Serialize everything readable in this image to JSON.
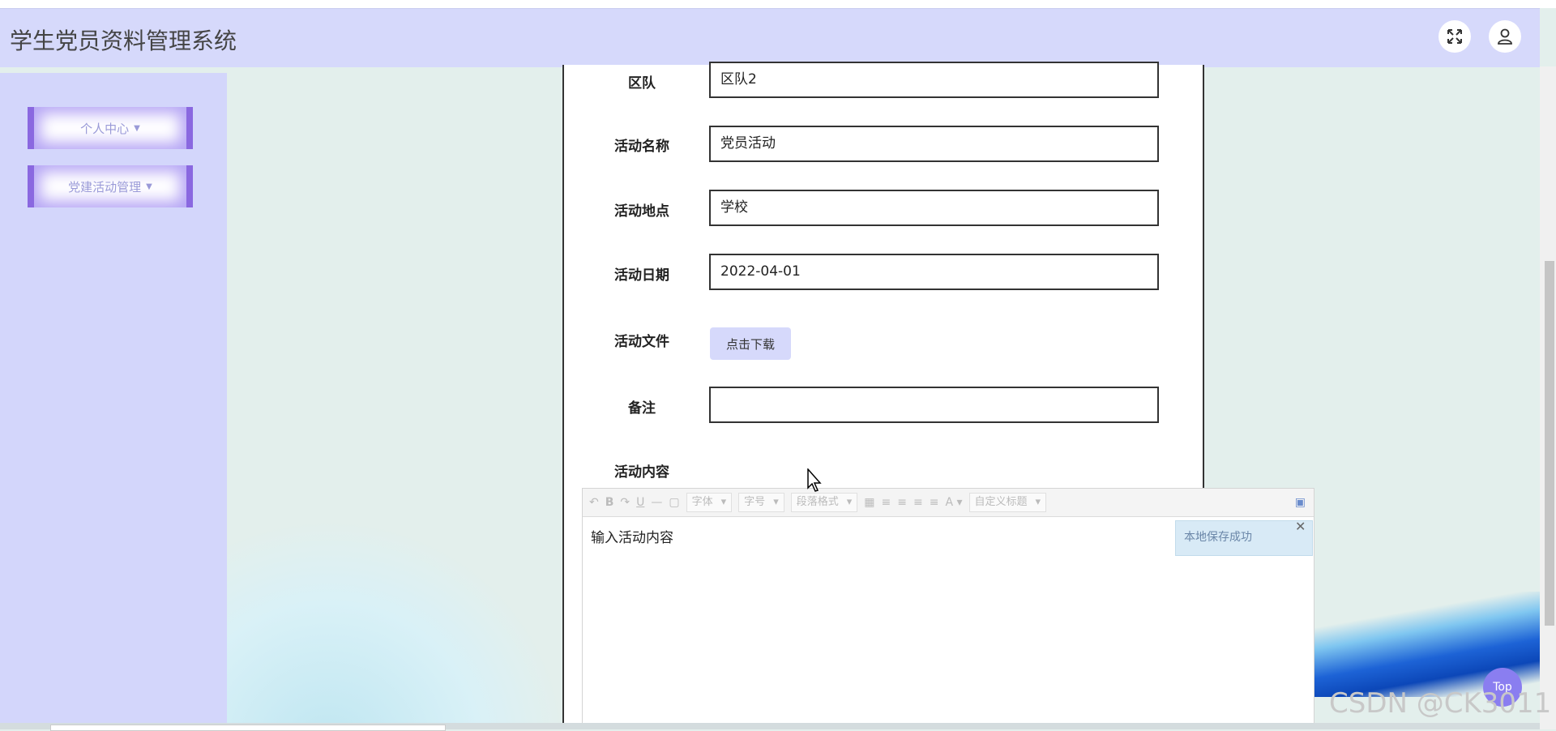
{
  "header": {
    "title": "学生党员资料管理系统",
    "icons": [
      "fullscreen-icon",
      "user-icon"
    ]
  },
  "sidebar": {
    "items": [
      {
        "label": "个人中心"
      },
      {
        "label": "党建活动管理"
      }
    ]
  },
  "form": {
    "fields": [
      {
        "label": "区队",
        "value": "区队2"
      },
      {
        "label": "活动名称",
        "value": "党员活动"
      },
      {
        "label": "活动地点",
        "value": "学校"
      },
      {
        "label": "活动日期",
        "value": "2022-04-01"
      },
      {
        "label": "活动文件",
        "button": "点击下载"
      },
      {
        "label": "备注",
        "value": ""
      },
      {
        "label": "活动内容"
      }
    ]
  },
  "editor": {
    "toolbar": {
      "font_select": "字体",
      "size_select": "字号",
      "paragraph_select": "段落格式",
      "custom_title_select": "自定义标题",
      "icons": [
        "undo-icon",
        "bold-icon",
        "redo-icon",
        "underline-icon",
        "hr-icon",
        "paste-icon",
        "table-icon",
        "align-left-icon",
        "align-center-icon",
        "align-right-icon",
        "align-justify-icon",
        "font-color-icon",
        "preview-icon"
      ]
    },
    "content_placeholder": "输入活动内容",
    "toast": "本地保存成功"
  },
  "back_to_top": "Top",
  "watermark": "CSDN @CK3011"
}
